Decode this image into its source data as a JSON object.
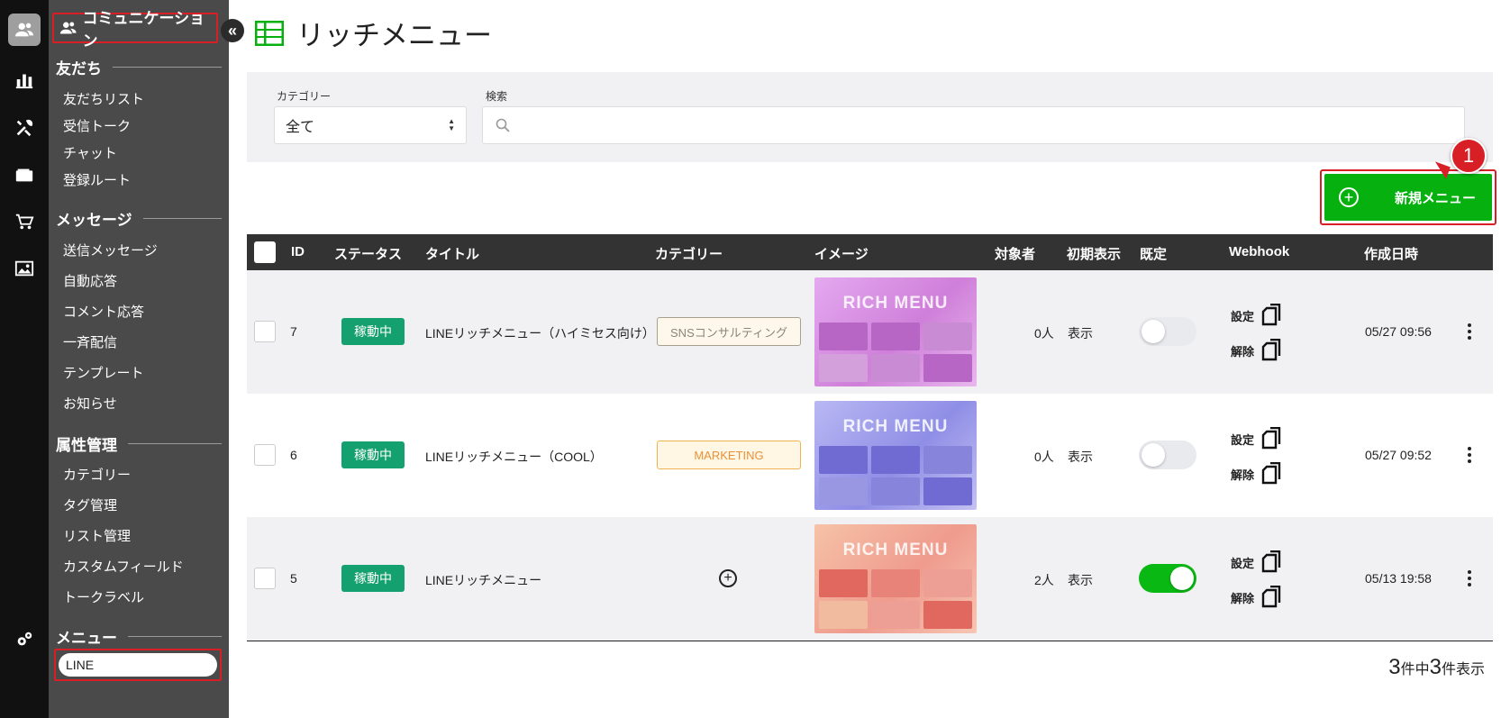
{
  "sidebar": {
    "title": "コミュニケーション",
    "collapse_icon": "«",
    "sections": [
      {
        "label": "友だち",
        "items": [
          "友だちリスト",
          "受信トーク",
          "チャット",
          "登録ルート"
        ]
      },
      {
        "label": "メッセージ",
        "items": [
          "送信メッセージ",
          "自動応答",
          "コメント応答",
          "一斉配信",
          "テンプレート",
          "お知らせ"
        ]
      },
      {
        "label": "属性管理",
        "items": [
          "カテゴリー",
          "タグ管理",
          "リスト管理",
          "カスタムフィールド",
          "トークラベル"
        ]
      },
      {
        "label": "メニュー",
        "items": [
          "LINE"
        ]
      }
    ]
  },
  "rail_icons": [
    "users-icon",
    "chart-icon",
    "tools-icon",
    "wallet-icon",
    "cart-icon",
    "image-icon",
    "gears-icon"
  ],
  "page": {
    "title": "リッチメニュー",
    "title_icon": "table-icon",
    "accent": "#06b10f"
  },
  "filters": {
    "category_label": "カテゴリー",
    "category_value": "全て",
    "search_label": "検索",
    "search_placeholder": ""
  },
  "new_button": {
    "label": "新規メニュー",
    "callout": "1"
  },
  "table": {
    "headers": [
      "ID",
      "ステータス",
      "タイトル",
      "カテゴリー",
      "イメージ",
      "対象者",
      "初期表示",
      "既定",
      "Webhook",
      "作成日時"
    ],
    "rows": [
      {
        "id": "7",
        "status": "稼動中",
        "title": "LINEリッチメニュー（ハイミセス向け）",
        "category": "SNSコンサルティング",
        "image_text": "RICH MENU",
        "target": "0人",
        "initial": "表示",
        "default_on": false,
        "webhook_set": "設定",
        "webhook_unset": "解除",
        "created": "05/27 09:56"
      },
      {
        "id": "6",
        "status": "稼動中",
        "title": "LINEリッチメニュー（COOL）",
        "category": "MARKETING",
        "image_text": "RICH MENU",
        "target": "0人",
        "initial": "表示",
        "default_on": false,
        "webhook_set": "設定",
        "webhook_unset": "解除",
        "created": "05/27 09:52"
      },
      {
        "id": "5",
        "status": "稼動中",
        "title": "LINEリッチメニュー",
        "category": "",
        "image_text": "RICH MENU",
        "target": "2人",
        "initial": "表示",
        "default_on": true,
        "webhook_set": "設定",
        "webhook_unset": "解除",
        "created": "05/13 19:58"
      }
    ]
  },
  "footer": {
    "total": "3",
    "mid": "件中",
    "shown": "3",
    "suffix": "件表示"
  }
}
